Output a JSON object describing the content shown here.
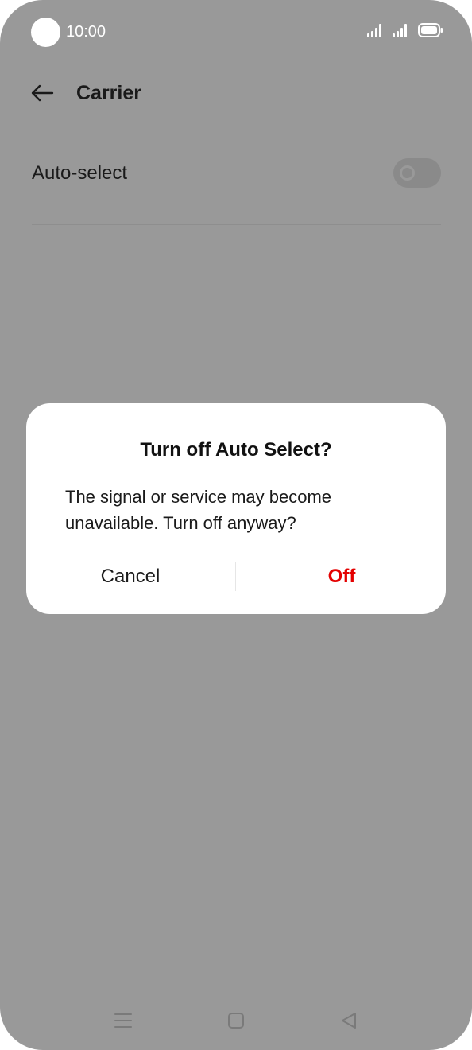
{
  "status_bar": {
    "time": "10:00",
    "icons": [
      "signal-icon",
      "signal-icon",
      "battery-icon"
    ]
  },
  "header": {
    "title": "Carrier",
    "back_icon": "back-arrow-icon"
  },
  "settings": {
    "auto_select": {
      "label": "Auto-select",
      "enabled": false
    }
  },
  "dialog": {
    "title": "Turn off Auto Select?",
    "message": "The signal or service may become unavailable. Turn off anyway?",
    "cancel_label": "Cancel",
    "confirm_label": "Off",
    "confirm_color": "#e40000"
  },
  "nav_bar": {
    "icons": [
      "menu-icon",
      "home-icon",
      "back-icon"
    ]
  },
  "colors": {
    "scrim": "#999999",
    "dialog_bg": "#ffffff"
  }
}
